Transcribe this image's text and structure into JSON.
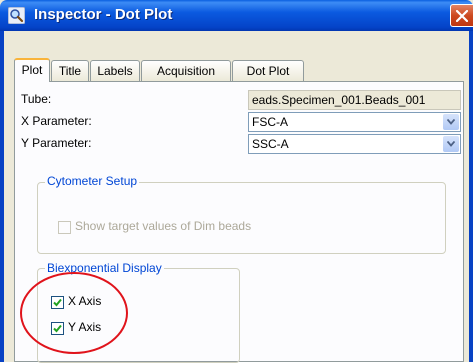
{
  "window": {
    "title": "Inspector - Dot Plot",
    "title_icon": "magnifier-icon",
    "close_icon": "close-icon",
    "colors": {
      "titlebar": "#0b5ae0",
      "close": "#cd4a20",
      "group_title": "#0046d5",
      "annotation": "#e0131b"
    }
  },
  "tabs": [
    {
      "label": "Plot",
      "selected": true
    },
    {
      "label": "Title",
      "selected": false
    },
    {
      "label": "Labels",
      "selected": false
    },
    {
      "label": "Acquisition",
      "selected": false
    },
    {
      "label": "Dot Plot",
      "selected": false
    }
  ],
  "plot": {
    "tube": {
      "label": "Tube:",
      "value": "eads.Specimen_001.Beads_001"
    },
    "x_parameter": {
      "label": "X Parameter:",
      "value": "FSC-A"
    },
    "y_parameter": {
      "label": "Y Parameter:",
      "value": "SSC-A"
    },
    "cytometer_setup": {
      "title": "Cytometer Setup",
      "show_target": {
        "label": "Show target values of Dim beads",
        "checked": false,
        "enabled": false
      }
    },
    "biexponential": {
      "title": "Biexponential Display",
      "x_axis": {
        "label": "X Axis",
        "checked": true
      },
      "y_axis": {
        "label": "Y Axis",
        "checked": true
      }
    }
  }
}
